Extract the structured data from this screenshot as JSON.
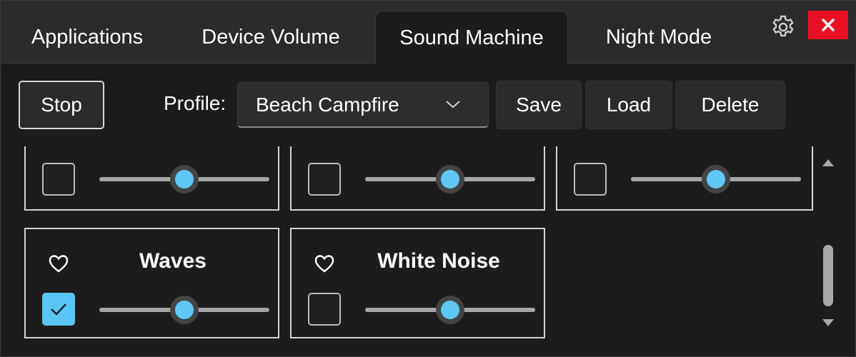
{
  "tabs": {
    "applications": "Applications",
    "device_volume": "Device Volume",
    "sound_machine": "Sound Machine",
    "night_mode": "Night Mode",
    "active": "Sound Machine"
  },
  "window_controls": {
    "settings_icon": "gear-icon",
    "close_icon": "close-icon",
    "close_color": "#e81123"
  },
  "toolbar": {
    "stop_label": "Stop",
    "profile_label": "Profile:",
    "profile_value": "Beach Campfire",
    "save_label": "Save",
    "load_label": "Load",
    "delete_label": "Delete"
  },
  "sounds": {
    "row1": [
      {
        "checked": false,
        "volume": 0.5
      },
      {
        "checked": false,
        "volume": 0.5
      },
      {
        "checked": false,
        "volume": 0.5
      }
    ],
    "row2": [
      {
        "name": "Waves",
        "checked": true,
        "favorite": false,
        "volume": 0.5
      },
      {
        "name": "White Noise",
        "checked": false,
        "favorite": false,
        "volume": 0.5
      }
    ]
  },
  "colors": {
    "accent": "#5fc8f7",
    "background": "#1c1c1c",
    "tabstrip": "#2b2b2b"
  }
}
